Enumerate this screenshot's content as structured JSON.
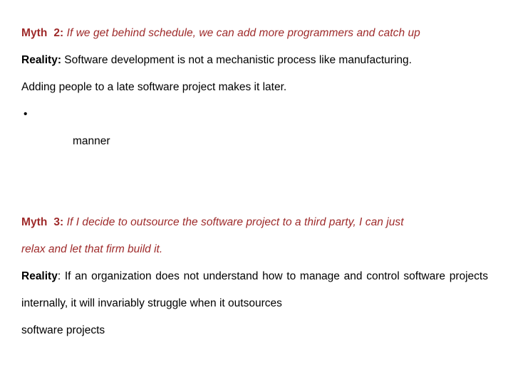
{
  "slide": {
    "background_color": "#ffffff",
    "accent_color": "#9E2A2A",
    "text_color": "#000000"
  },
  "blocks": {
    "myth2": {
      "label": "Myth",
      "number": "2:",
      "statement": " If we get behind schedule, we can add more programmers and catch up",
      "reality_label": "Reality:",
      "reality_text": " Software development is not a mechanistic process like manufacturing.",
      "reality_line2": "Adding people to a late software project makes it later.",
      "bullet_marker": "•",
      "bullet_text": "",
      "sub_text": "manner"
    },
    "myth3": {
      "label": "Myth",
      "number": "3:",
      "statement": " If I decide to outsource the software project to a third party, I can just",
      "statement_line2": "relax and let that firm build it.",
      "reality_label": "Reality",
      "reality_colon": ":",
      "reality_text": " If an organization does not understand how to manage and control software projects internally, it will invariably struggle when it outsources",
      "reality_line_last": "software projects"
    }
  }
}
